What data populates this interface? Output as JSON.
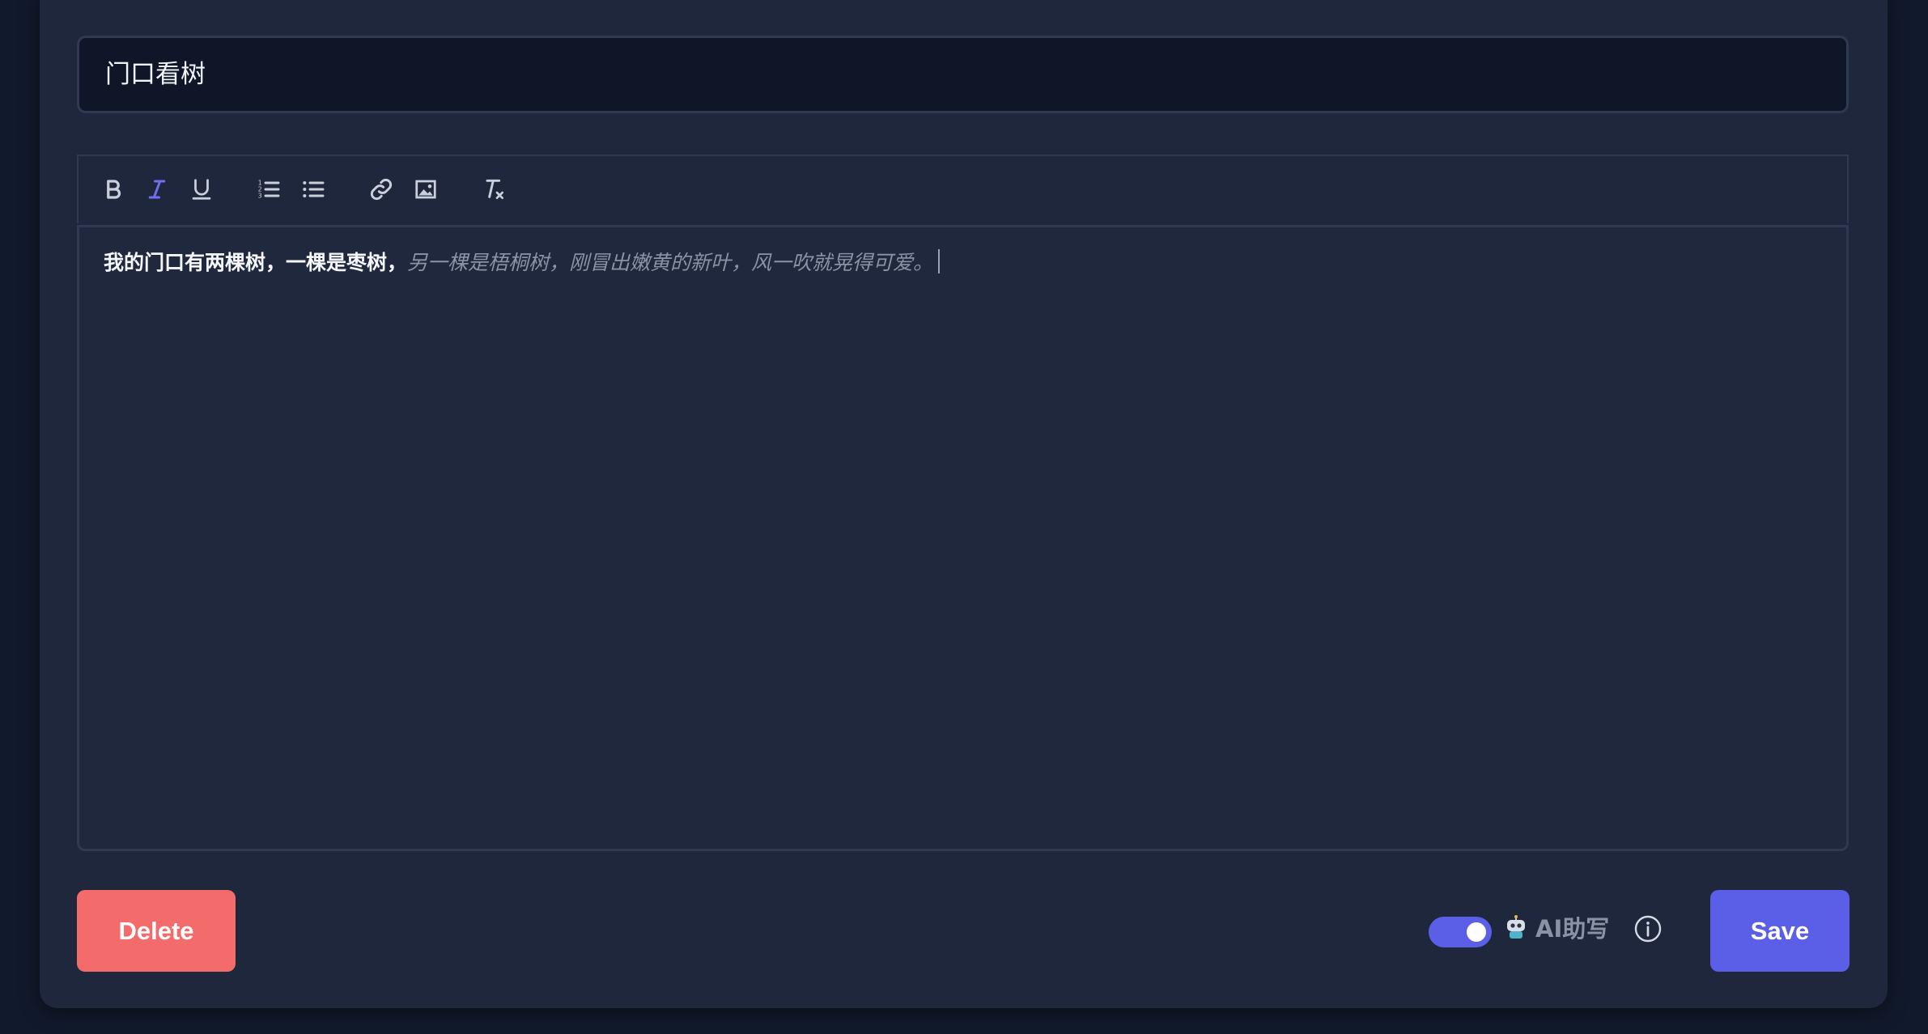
{
  "note": {
    "title_value": "门口看树",
    "body_typed": "我的门口有两棵树，一棵是枣树，",
    "body_suggestion": "另一棵是梧桐树，刚冒出嫩黄的新叶，风一吹就晃得可爱。"
  },
  "toolbar": {
    "buttons": [
      {
        "name": "bold",
        "icon": "bold-icon"
      },
      {
        "name": "italic",
        "icon": "italic-icon",
        "active": true
      },
      {
        "name": "underline",
        "icon": "underline-icon"
      },
      {
        "name": "ordered-list",
        "icon": "ordered-list-icon"
      },
      {
        "name": "bullet-list",
        "icon": "bullet-list-icon"
      },
      {
        "name": "link",
        "icon": "link-icon"
      },
      {
        "name": "image",
        "icon": "image-icon"
      },
      {
        "name": "clear-format",
        "icon": "clear-format-icon"
      }
    ]
  },
  "footer": {
    "delete_label": "Delete",
    "save_label": "Save",
    "ai_toggle_on": true,
    "ai_label": "AI助写",
    "ai_icon": "robot-icon",
    "info_icon": "info-icon"
  },
  "colors": {
    "page_bg": "#111a2c",
    "card_bg": "#1e273b",
    "input_bg": "#0e1628",
    "accent": "#5b5ee6",
    "danger": "#f36b6b",
    "suggestion_text": "#8b93a5",
    "active_icon": "#6f6ff0"
  }
}
